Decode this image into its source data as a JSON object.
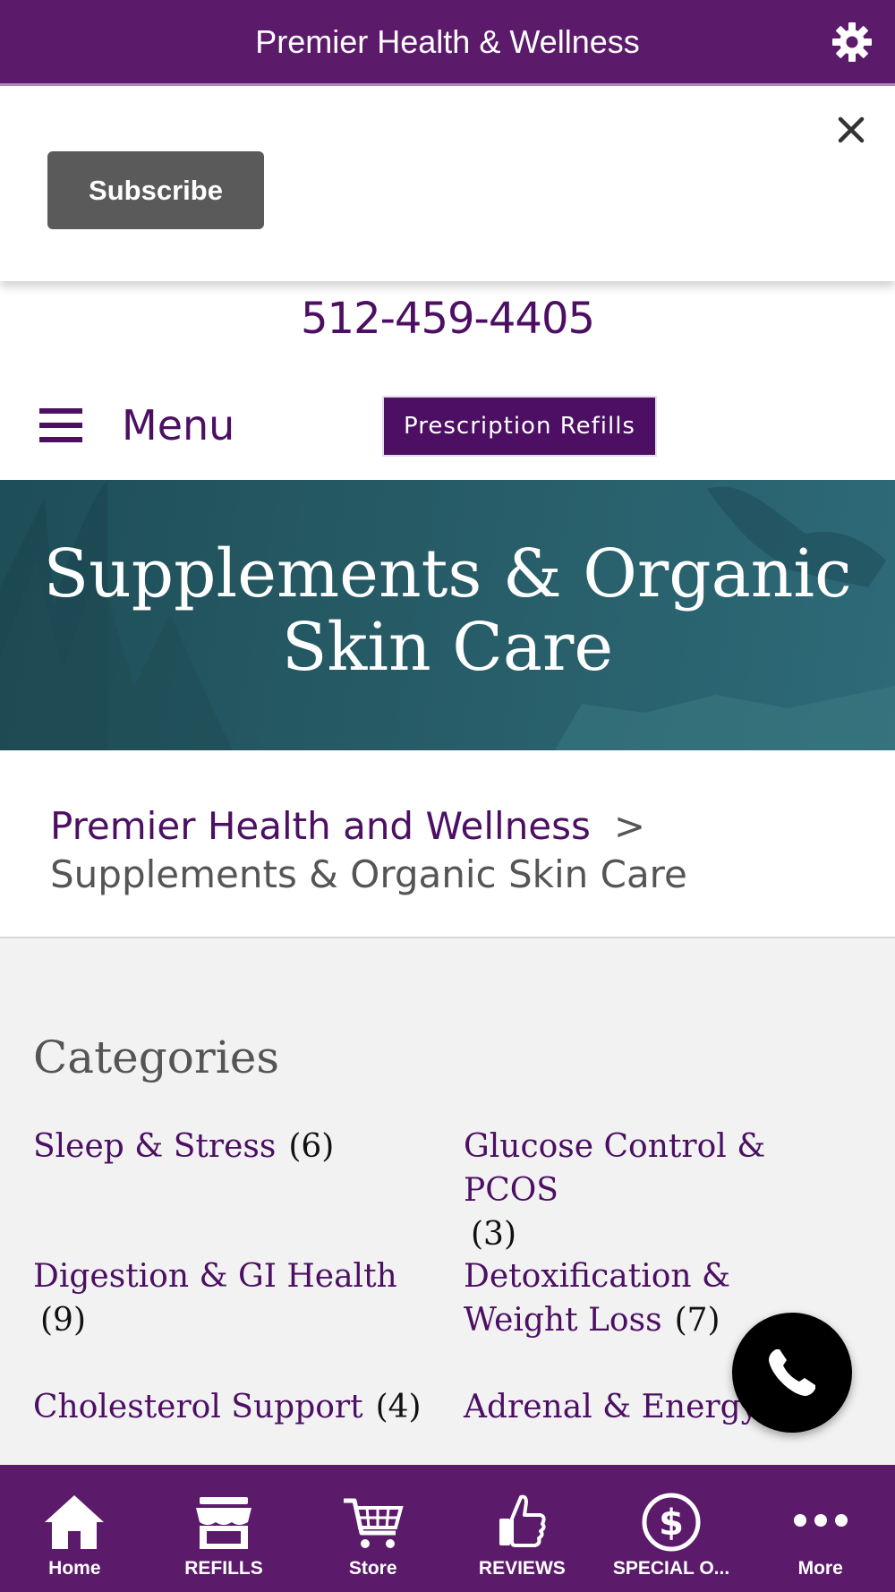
{
  "top_bar": {
    "title": "Premier Health & Wellness",
    "settings_icon": "gear-icon"
  },
  "subscribe_panel": {
    "button_label": "Subscribe",
    "close_icon": "close-icon"
  },
  "contact": {
    "phone": "512-459-4405"
  },
  "menu": {
    "label": "Menu",
    "icon": "hamburger-icon",
    "refill_button": "Prescription Refills"
  },
  "hero": {
    "title_line1": "Supplements & Organic",
    "title_line2": "Skin Care"
  },
  "breadcrumb": {
    "parent": "Premier Health and Wellness",
    "separator": ">",
    "current": "Supplements & Organic Skin Care"
  },
  "categories": {
    "heading": "Categories",
    "items": [
      {
        "label": "Sleep & Stress",
        "count": "(6)"
      },
      {
        "label": "Glucose Control & PCOS",
        "count": "(3)"
      },
      {
        "label": "Digestion & GI Health",
        "count": "(9)"
      },
      {
        "label": "Detoxification & Weight Loss",
        "count": "(7)"
      },
      {
        "label": "Cholesterol Support",
        "count": "(4)"
      },
      {
        "label": "Adrenal & Energy",
        "count": ""
      }
    ]
  },
  "fab": {
    "icon": "phone-icon"
  },
  "tab_bar": {
    "tabs": [
      {
        "label": "Home",
        "icon": "home-icon"
      },
      {
        "label": "REFILLS",
        "icon": "storefront-icon"
      },
      {
        "label": "Store",
        "icon": "cart-icon"
      },
      {
        "label": "REVIEWS",
        "icon": "thumbs-up-icon"
      },
      {
        "label": "SPECIAL O...",
        "icon": "dollar-icon"
      },
      {
        "label": "More",
        "icon": "more-icon"
      }
    ]
  },
  "colors": {
    "brand_purple": "#5c1a6b",
    "link_purple": "#4c0f63",
    "hero_teal": "#265b66",
    "panel_gray": "#f2f2f2"
  }
}
